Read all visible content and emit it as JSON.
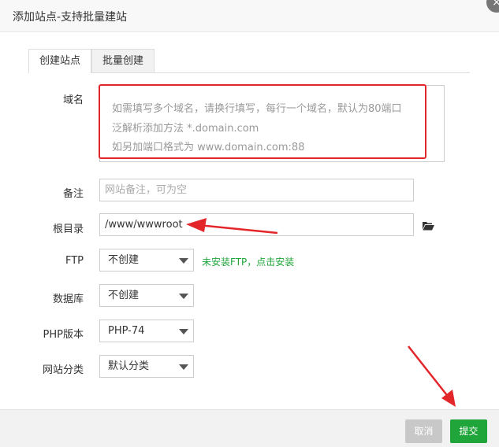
{
  "dialog": {
    "title": "添加站点-支持批量建站",
    "close_icon": "close-icon"
  },
  "tabs": [
    {
      "label": "创建站点",
      "active": true
    },
    {
      "label": "批量创建",
      "active": false
    }
  ],
  "form": {
    "domain": {
      "label": "域名",
      "placeholder_lines": [
        "如需填写多个域名，请换行填写，每行一个域名，默认为80端口",
        "泛解析添加方法 *.domain.com",
        "如另加端口格式为 www.domain.com:88"
      ]
    },
    "remark": {
      "label": "备注",
      "placeholder": "网站备注，可为空"
    },
    "root": {
      "label": "根目录",
      "value": "/www/wwwroot",
      "icon": "folder-open-icon"
    },
    "ftp": {
      "label": "FTP",
      "value": "不创建",
      "hint": "未安装FTP，点击安装"
    },
    "database": {
      "label": "数据库",
      "value": "不创建"
    },
    "php": {
      "label": "PHP版本",
      "value": "PHP-74"
    },
    "category": {
      "label": "网站分类",
      "value": "默认分类"
    }
  },
  "footer": {
    "cancel_label": "取消",
    "submit_label": "提交"
  },
  "colors": {
    "accent": "#20a53a",
    "annotation_red": "#e3262a"
  }
}
